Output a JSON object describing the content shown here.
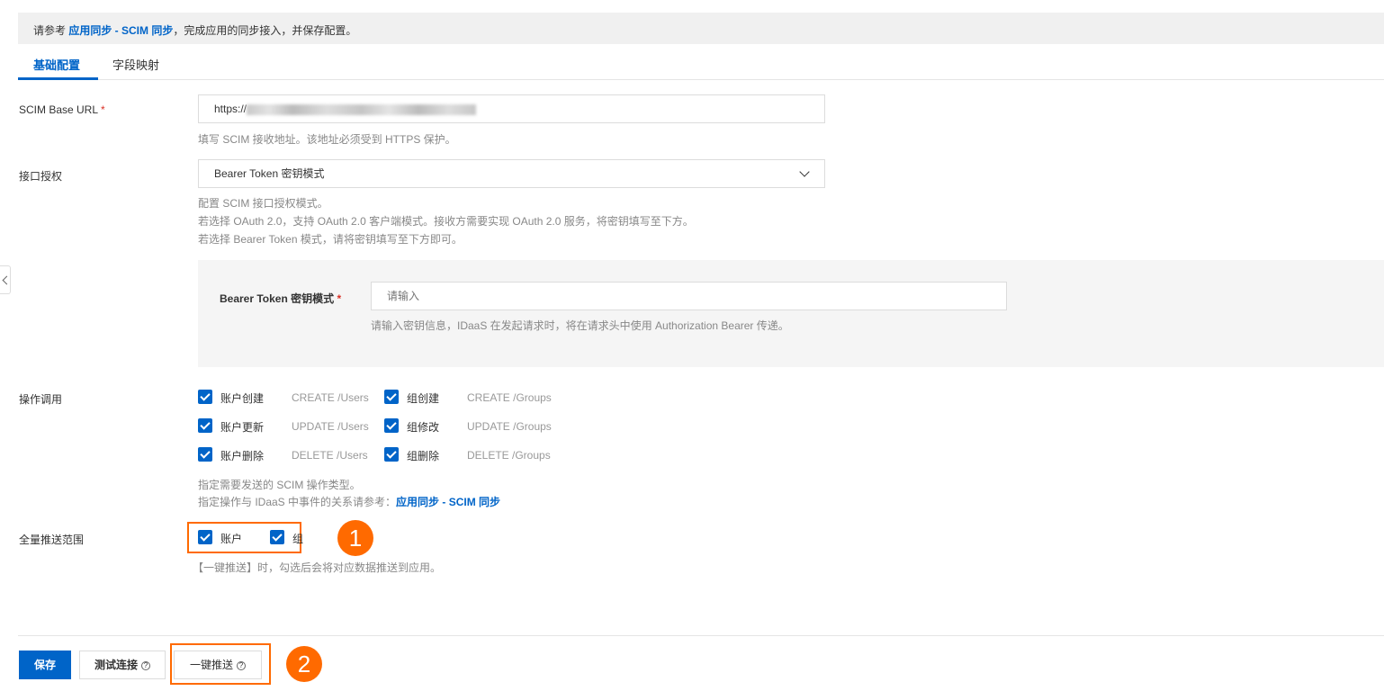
{
  "notice": {
    "prefix": "请参考 ",
    "link": "应用同步 - SCIM 同步",
    "suffix": "，完成应用的同步接入，并保存配置。"
  },
  "tabs": [
    {
      "label": "基础配置",
      "active": true
    },
    {
      "label": "字段映射",
      "active": false
    }
  ],
  "scim_url": {
    "label": "SCIM Base URL",
    "required": "*",
    "value": "https://",
    "help": "填写 SCIM 接收地址。该地址必须受到 HTTPS 保护。"
  },
  "auth": {
    "label": "接口授权",
    "value": "Bearer Token 密钥模式",
    "help": [
      "配置 SCIM 接口授权模式。",
      "若选择 OAuth 2.0，支持 OAuth 2.0 客户端模式。接收方需要实现 OAuth 2.0 服务，将密钥填写至下方。",
      "若选择 Bearer Token 模式，请将密钥填写至下方即可。"
    ]
  },
  "token": {
    "label": "Bearer Token 密钥模式",
    "required": "*",
    "placeholder": "请输入",
    "help": "请输入密钥信息，IDaaS 在发起请求时，将在请求头中使用 Authorization Bearer 传递。"
  },
  "operations": {
    "label": "操作调用",
    "items": [
      {
        "label": "账户创建",
        "op": "CREATE /Users",
        "checked": true
      },
      {
        "label": "组创建",
        "op": "CREATE /Groups",
        "checked": true
      },
      {
        "label": "账户更新",
        "op": "UPDATE /Users",
        "checked": true
      },
      {
        "label": "组修改",
        "op": "UPDATE /Groups",
        "checked": true
      },
      {
        "label": "账户删除",
        "op": "DELETE /Users",
        "checked": true
      },
      {
        "label": "组删除",
        "op": "DELETE /Groups",
        "checked": true
      }
    ],
    "help1": "指定需要发送的 SCIM 操作类型。",
    "help2_prefix": "指定操作与 IDaaS 中事件的关系请参考：",
    "help2_link": "应用同步 - SCIM 同步"
  },
  "scope": {
    "label": "全量推送范围",
    "items": [
      {
        "label": "账户",
        "checked": true
      },
      {
        "label": "组",
        "checked": true
      }
    ],
    "help": "【一键推送】时，勾选后会将对应数据推送到应用。"
  },
  "annotations": {
    "one": "1",
    "two": "2"
  },
  "buttons": {
    "save": "保存",
    "test": "测试连接",
    "push": "一键推送",
    "help_icon": "?"
  },
  "colors": {
    "primary": "#0064c8",
    "annotation": "#ff6a00"
  }
}
